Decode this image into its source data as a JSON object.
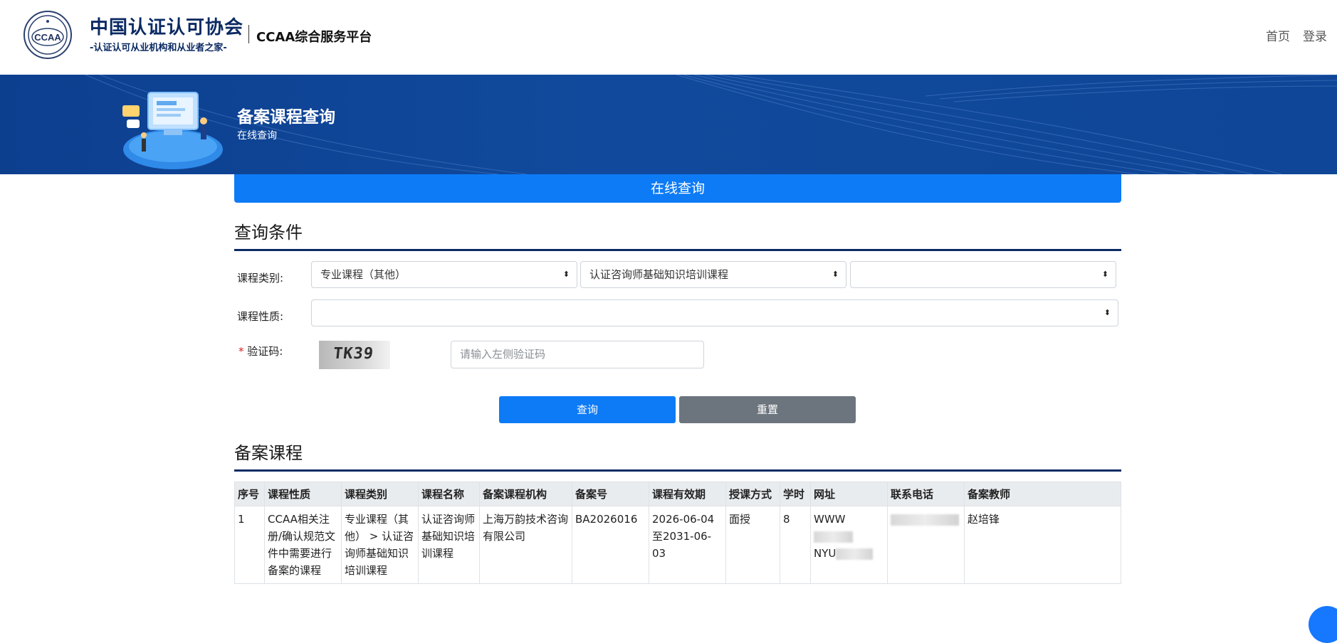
{
  "header": {
    "org_name": "中国认证认可协会",
    "org_slogan": "-认证认可从业机构和从业者之家-",
    "logo_text": "CCAA",
    "platform_name": "CCAA综合服务平台",
    "nav": [
      "首页",
      "登录"
    ]
  },
  "banner": {
    "title": "备案课程查询",
    "subtitle": "在线查询"
  },
  "query_bar": {
    "label": "在线查询"
  },
  "query_section": {
    "title": "查询条件",
    "course_category_label": "课程类别:",
    "course_category_values": [
      "专业课程（其他）",
      "认证咨询师基础知识培训课程",
      ""
    ],
    "course_nature_label": "课程性质:",
    "course_nature_value": "",
    "captcha_required_mark": "*",
    "captcha_label": "验证码:",
    "captcha_image_text": "TK39",
    "captcha_input_placeholder": "请输入左侧验证码",
    "query_button": "查询",
    "reset_button": "重置"
  },
  "results": {
    "title": "备案课程",
    "columns": [
      "序号",
      "课程性质",
      "课程类别",
      "课程名称",
      "备案课程机构",
      "备案号",
      "课程有效期",
      "授课方式",
      "学时",
      "网址",
      "联系电话",
      "备案教师"
    ],
    "rows": [
      {
        "no": "1",
        "nature": "CCAA相关注册/确认规范文件中需要进行备案的课程",
        "category": "专业课程（其他） > 认证咨询师基础知识培训课程",
        "name": "认证咨询师基础知识培训课程",
        "org": "上海万韵技术咨询有限公司",
        "record_no": "BA2026016",
        "validity": "2026-06-04至2031-06-03",
        "mode": "面授",
        "hours": "8",
        "url_prefix_1": "WWW",
        "url_prefix_2": "NYU",
        "teacher": "赵培锋"
      }
    ]
  },
  "colors": {
    "brand_navy": "#0b2a63",
    "primary_blue": "#0d7bf6",
    "banner_blue": "#114a9c",
    "secondary_gray": "#6c757d"
  }
}
